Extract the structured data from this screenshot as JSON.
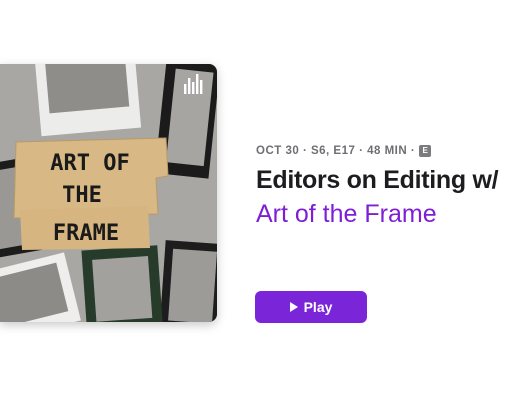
{
  "episode": {
    "meta": "OCT 30 · S6, E17 · 48 MIN ·",
    "explicit_badge": "E",
    "title": "Editors on Editing w/",
    "show_name": "Art of the Frame",
    "play_label": "Play"
  },
  "artwork": {
    "text_line1": "ART OF",
    "text_line2": "THE",
    "text_line3": "FRAME",
    "logo_icon": "podcast-waveform-icon"
  },
  "colors": {
    "accent": "#7b25d9",
    "show_name": "#7e1fd6",
    "meta_text": "#6e6e73",
    "title_text": "#1d1d1f",
    "paper_label": "#d8b884"
  }
}
